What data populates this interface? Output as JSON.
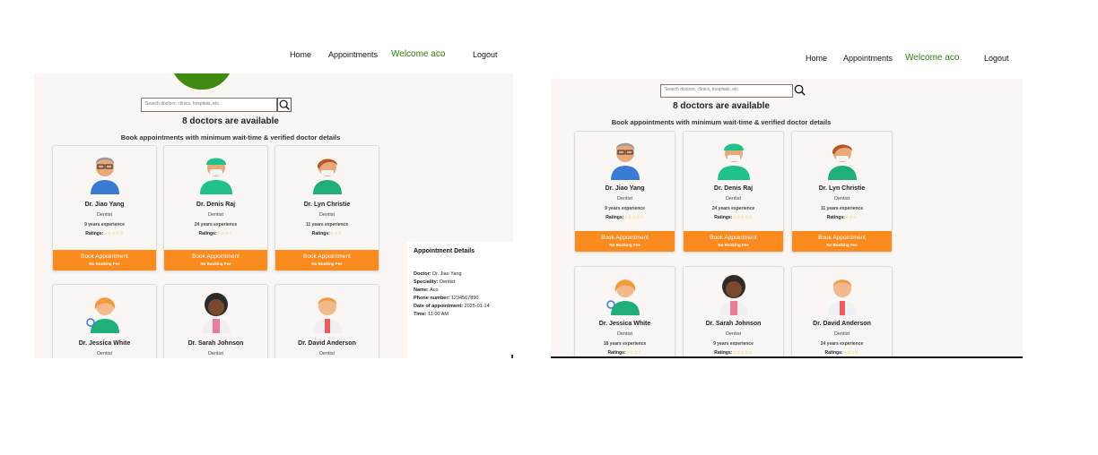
{
  "nav": {
    "home": "Home",
    "appointments": "Appointments",
    "welcome": "Welcome aco",
    "logout": "Logout"
  },
  "search": {
    "placeholder": "Search doctors, clinics, hospitals, etc."
  },
  "available_text": "8 doctors are available",
  "tagline": "Book appointments with minimum wait-time & verified doctor details",
  "book_label": "Book Appointment",
  "no_fee_label": "No Booking Fee",
  "ratings_label": "Ratings:",
  "left_doctors": [
    {
      "name": "Dr. Jiao Yang",
      "spec": "Dentist",
      "exp": "9 years experience",
      "stars": "☆☆☆☆☆"
    },
    {
      "name": "Dr. Denis Raj",
      "spec": "Dentist",
      "exp": "24 years experience",
      "stars": "☆☆☆☆"
    },
    {
      "name": "Dr. Lyn Christie",
      "spec": "Dentist",
      "exp": "11 years experience",
      "stars": "☆☆☆"
    },
    {
      "name": "Dr. Jessica White",
      "spec": "Dentist"
    },
    {
      "name": "Dr. Sarah Johnson",
      "spec": "Dentist"
    },
    {
      "name": "Dr. David Anderson",
      "spec": "Dentist"
    }
  ],
  "right_doctors": [
    {
      "name": "Dr. Jiao Yang",
      "spec": "Dentist",
      "exp": "9 years experience",
      "stars": "☆☆☆☆☆"
    },
    {
      "name": "Dr. Denis Raj",
      "spec": "Dentist",
      "exp": "24 years experience",
      "stars": "☆☆☆☆☆"
    },
    {
      "name": "Dr. Lyn Christie",
      "spec": "Dentist",
      "exp": "11 years experience",
      "stars": "☆☆☆"
    },
    {
      "name": "Dr. Jessica White",
      "spec": "Dentist",
      "exp": "18 years experience",
      "stars": "☆☆☆☆"
    },
    {
      "name": "Dr. Sarah Johnson",
      "spec": "Dentist",
      "exp": "9 years experience",
      "stars": "☆☆☆☆☆"
    },
    {
      "name": "Dr. David Anderson",
      "spec": "Dentist",
      "exp": "24 years experience",
      "stars": "☆☆☆☆"
    }
  ],
  "appointment": {
    "title": "Appointment Details",
    "doctor_label": "Doctor:",
    "doctor": "Dr. Jiao Yang",
    "speciality_label": "Speciality:",
    "speciality": "Dentist",
    "name_label": "Name:",
    "name": "Aco",
    "phone_label": "Phone number:",
    "phone": "1234567890",
    "date_label": "Date of appointment:",
    "date": "2025-01-14",
    "time_label": "Time:",
    "time": "11:00 AM"
  },
  "colors": {
    "accent_orange": "#fb8a1f",
    "welcome_green": "#2e7d0b",
    "page_bg": "#faf6f3"
  }
}
